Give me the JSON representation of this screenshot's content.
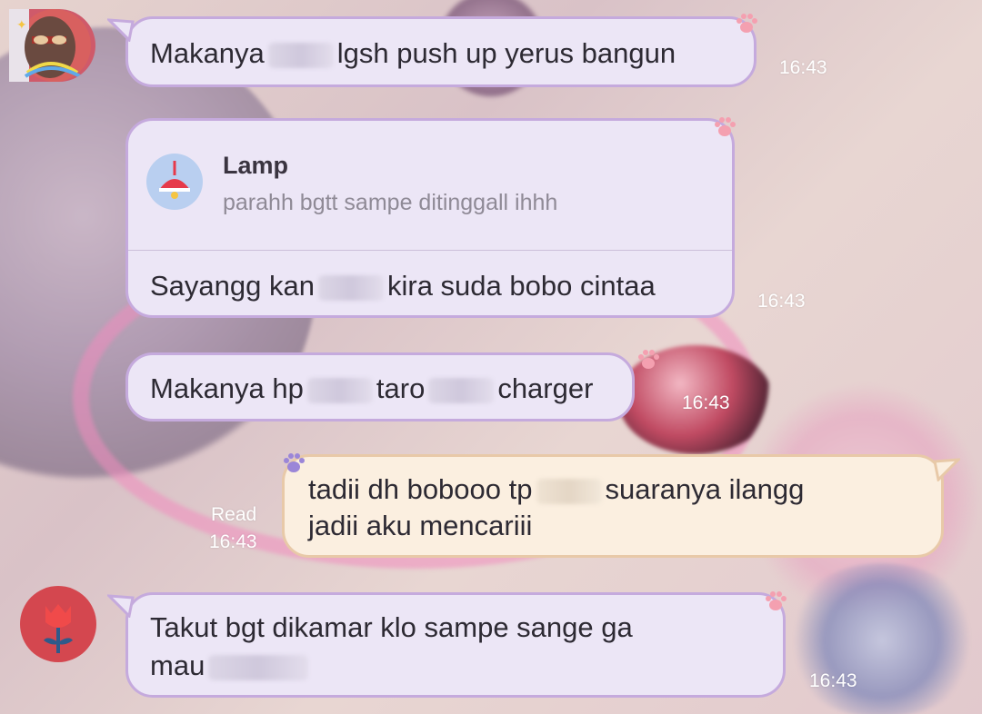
{
  "messages": [
    {
      "id": "m1",
      "segments": [
        "Makanya",
        "lgsh push up yerus bangun"
      ],
      "time": "16:43"
    },
    {
      "id": "m2",
      "reply": {
        "author": "Lamp",
        "text": "parahh bgtt sampe ditinggall ihhh"
      },
      "segments": [
        "Sayangg kan",
        "kira suda bobo cintaa"
      ],
      "time": "16:43"
    },
    {
      "id": "m3",
      "segments": [
        "Makanya hp",
        "taro",
        "charger"
      ],
      "time": "16:43"
    },
    {
      "id": "m4",
      "line1": [
        "tadii dh bobooo tp",
        "suaranya ilangg"
      ],
      "line2": "jadii aku mencariii",
      "read": "Read",
      "time": "16:43"
    },
    {
      "id": "m5",
      "line1": "Takut bgt dikamar klo sampe sange ga",
      "line2": "mau",
      "time": "16:43"
    }
  ],
  "icons": {
    "paw": "paw-icon",
    "lamp": "lamp-icon",
    "tulip": "tulip-icon"
  },
  "colors": {
    "bubble": "#ece6f6",
    "bubble_border": "#c5aadd",
    "mine_bubble": "#fbefe0",
    "mine_border": "#e8c9a8",
    "time": "#ffffff",
    "accent": "#e63a4a"
  }
}
